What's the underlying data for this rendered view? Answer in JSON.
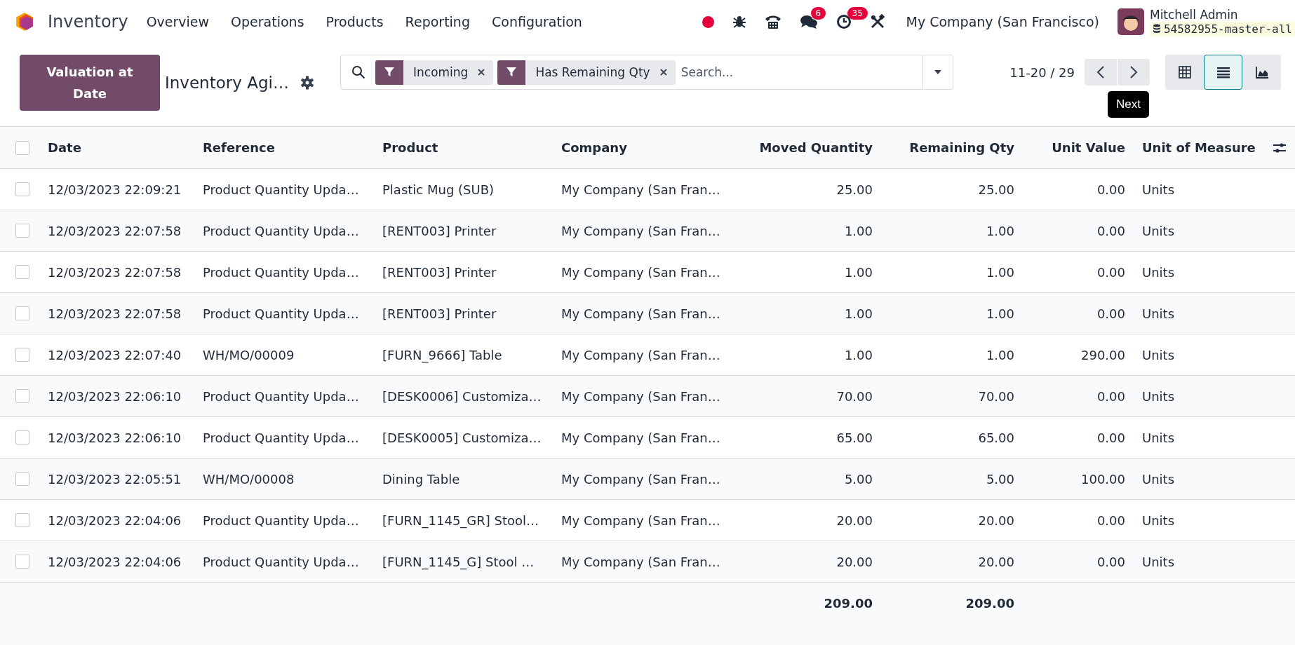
{
  "navbar": {
    "app_name": "Inventory",
    "menus": [
      "Overview",
      "Operations",
      "Products",
      "Reporting",
      "Configuration"
    ],
    "messages_badge": "6",
    "activities_badge": "35",
    "company": "My Company (San Francisco)",
    "user_name": "Mitchell Admin",
    "database": "54582955-master-all"
  },
  "control_panel": {
    "primary_button": "Valuation at Date",
    "title": "Inventory Agi…",
    "filters": [
      {
        "label": "Incoming"
      },
      {
        "label": "Has Remaining Qty"
      }
    ],
    "search": {
      "placeholder": "Search..."
    },
    "pager": "11-20 / 29",
    "tooltip": "Next",
    "views": [
      {
        "kind": "pivot",
        "selected": false
      },
      {
        "kind": "list",
        "selected": true
      },
      {
        "kind": "graph",
        "selected": false
      }
    ]
  },
  "table": {
    "select_all_checked": false,
    "columns": [
      {
        "label": "Date",
        "kind": "text"
      },
      {
        "label": "Reference",
        "kind": "text"
      },
      {
        "label": "Product",
        "kind": "text"
      },
      {
        "label": "Company",
        "kind": "text"
      },
      {
        "label": "Moved Quantity",
        "kind": "number",
        "total": "209.00"
      },
      {
        "label": "Remaining Qty",
        "kind": "number",
        "total": "209.00"
      },
      {
        "label": "Unit Value",
        "kind": "number"
      },
      {
        "label": "Unit of Measure",
        "kind": "text"
      }
    ],
    "rows": [
      {
        "selected": false,
        "cells": [
          "12/03/2023 22:09:21",
          "Product Quantity Upda…",
          "Plastic Mug (SUB)",
          "My Company (San Fran…",
          "25.00",
          "25.00",
          "0.00",
          "Units"
        ]
      },
      {
        "selected": false,
        "cells": [
          "12/03/2023 22:07:58",
          "Product Quantity Upda…",
          "[RENT003] Printer",
          "My Company (San Fran…",
          "1.00",
          "1.00",
          "0.00",
          "Units"
        ]
      },
      {
        "selected": false,
        "cells": [
          "12/03/2023 22:07:58",
          "Product Quantity Upda…",
          "[RENT003] Printer",
          "My Company (San Fran…",
          "1.00",
          "1.00",
          "0.00",
          "Units"
        ]
      },
      {
        "selected": false,
        "cells": [
          "12/03/2023 22:07:58",
          "Product Quantity Upda…",
          "[RENT003] Printer",
          "My Company (San Fran…",
          "1.00",
          "1.00",
          "0.00",
          "Units"
        ]
      },
      {
        "selected": false,
        "cells": [
          "12/03/2023 22:07:40",
          "WH/MO/00009",
          "[FURN_9666] Table",
          "My Company (San Fran…",
          "1.00",
          "1.00",
          "290.00",
          "Units"
        ]
      },
      {
        "selected": false,
        "cells": [
          "12/03/2023 22:06:10",
          "Product Quantity Upda…",
          "[DESK0006] Customiza…",
          "My Company (San Fran…",
          "70.00",
          "70.00",
          "0.00",
          "Units"
        ]
      },
      {
        "selected": false,
        "cells": [
          "12/03/2023 22:06:10",
          "Product Quantity Upda…",
          "[DESK0005] Customiza…",
          "My Company (San Fran…",
          "65.00",
          "65.00",
          "0.00",
          "Units"
        ]
      },
      {
        "selected": false,
        "cells": [
          "12/03/2023 22:05:51",
          "WH/MO/00008",
          "Dining Table",
          "My Company (San Fran…",
          "5.00",
          "5.00",
          "100.00",
          "Units"
        ]
      },
      {
        "selected": false,
        "cells": [
          "12/03/2023 22:04:06",
          "Product Quantity Upda…",
          "[FURN_1145_GR] Stool…",
          "My Company (San Fran…",
          "20.00",
          "20.00",
          "0.00",
          "Units"
        ]
      },
      {
        "selected": false,
        "cells": [
          "12/03/2023 22:04:06",
          "Product Quantity Upda…",
          "[FURN_1145_G] Stool …",
          "My Company (San Fran…",
          "20.00",
          "20.00",
          "0.00",
          "Units"
        ]
      }
    ]
  }
}
